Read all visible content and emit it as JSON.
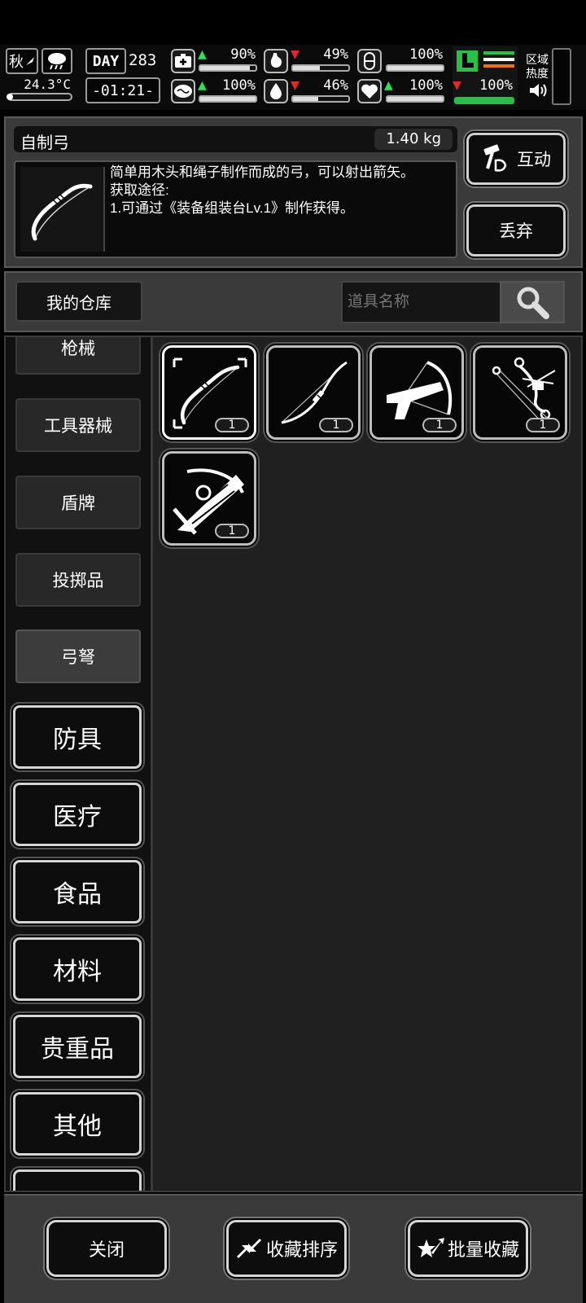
{
  "hud": {
    "season": "秋",
    "temperature": "24.3°C",
    "day_label": "DAY",
    "day_number": "283",
    "clock": "-01:21-",
    "region_heat_label": "区域\n热度",
    "stats": [
      {
        "icon": "medkit-icon",
        "arrow": "up",
        "value": "90%",
        "level": 0.9
      },
      {
        "icon": "stomach-icon",
        "arrow": "down",
        "value": "49%",
        "level": 0.49
      },
      {
        "icon": "pill-icon",
        "arrow": "none",
        "value": "100%",
        "level": 1.0
      },
      {
        "icon": "brain-icon",
        "arrow": "up",
        "value": "100%",
        "level": 1.0
      },
      {
        "icon": "water-drop-icon",
        "arrow": "down",
        "value": "46%",
        "level": 0.46
      },
      {
        "icon": "heart-icon",
        "arrow": "up",
        "value": "100%",
        "level": 1.0
      },
      {
        "icon": "boot-icon",
        "arrow": "down",
        "value": "100%",
        "level": 1.0
      }
    ]
  },
  "item": {
    "name": "自制弓",
    "weight": "1.40 kg",
    "description": "简单用木头和绳子制作而成的弓，可以射出箭矢。\n获取途径:\n1.可通过《装备组装台Lv.1》制作获得。"
  },
  "actions": {
    "interact": "互动",
    "discard": "丢弃"
  },
  "warehouse": {
    "title": "我的仓库",
    "search_placeholder": "道具名称"
  },
  "sub_categories": [
    "枪械",
    "工具器械",
    "盾牌",
    "投掷品",
    "弓弩"
  ],
  "main_categories": [
    "防具",
    "医疗",
    "食品",
    "材料",
    "贵重品",
    "其他"
  ],
  "slots": [
    {
      "icon": "recurve-bow-icon",
      "qty": "1",
      "selected": true
    },
    {
      "icon": "long-bow-icon",
      "qty": "1",
      "selected": false
    },
    {
      "icon": "pistol-crossbow-icon",
      "qty": "1",
      "selected": false
    },
    {
      "icon": "compound-bow-icon",
      "qty": "1",
      "selected": false
    },
    {
      "icon": "compound-crossbow-icon",
      "qty": "1",
      "selected": false
    }
  ],
  "bottom": {
    "close": "关闭",
    "sort_favorites": "收藏排序",
    "batch_favorite": "批量收藏"
  }
}
